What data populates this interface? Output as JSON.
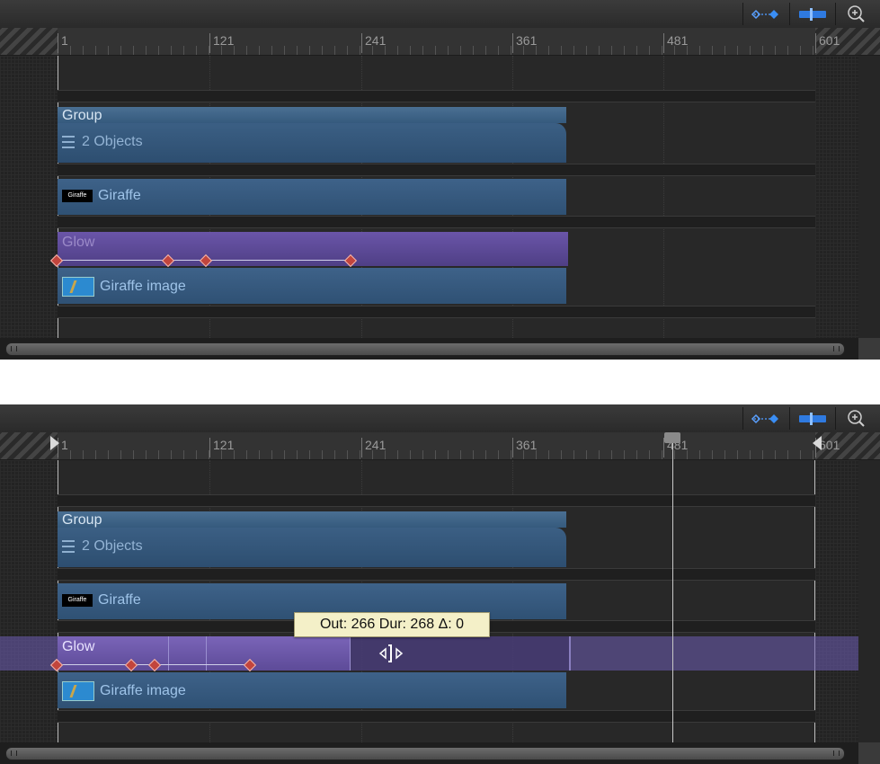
{
  "ruler": {
    "ticks": [
      "1",
      "121",
      "241",
      "361",
      "481",
      "601"
    ]
  },
  "tracks": {
    "group": {
      "label": "Group",
      "sublabel": "2 Objects"
    },
    "giraffe": {
      "label": "Giraffe",
      "thumb_text": "Giraffe"
    },
    "glow": {
      "label": "Glow"
    },
    "giraffe_image": {
      "label": "Giraffe image"
    }
  },
  "tooltip": {
    "text": "Out: 266 Dur: 268 Δ: 0"
  },
  "icons": {
    "keyframe": "keyframe-curve-icon",
    "clip": "clip-icon",
    "zoom": "zoom-icon",
    "trim": "trim-cursor-icon"
  },
  "colors": {
    "layer": "#3a5e83",
    "glow": "#5e4b9a",
    "keyframe": "#c2453d",
    "background": "#262626"
  }
}
